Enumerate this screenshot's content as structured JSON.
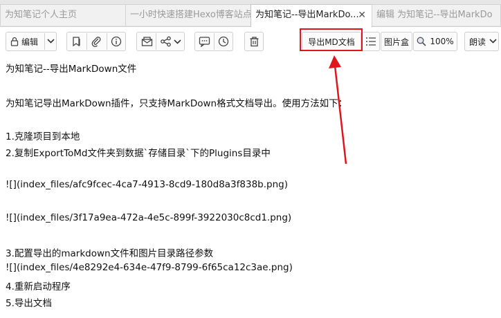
{
  "tabs": [
    {
      "label": "为知笔记个人主页"
    },
    {
      "label": "一小时快速搭建Hexo博客站点"
    },
    {
      "label": "为知笔记--导出MarkDo...",
      "close": "✕"
    },
    {
      "label": "编辑 为知笔记--导出MarkDo"
    }
  ],
  "toolbar": {
    "edit_label": "编辑",
    "export_md_label": "导出MD文档",
    "image_box_label": "图片盒",
    "zoom_label": "100%",
    "read_label": "朗读"
  },
  "colors": {
    "annotation": "#e0141b",
    "tab_bar": "#e6e6e6"
  },
  "document": {
    "title": "为知笔记--导出MarkDown文件",
    "intro": "为知笔记导出MarkDown插件，只支持MarkDown格式文档导出。使用方法如下：",
    "step1": "1.克隆项目到本地",
    "step2": "2.复制ExportToMd文件夹到数据`存储目录`下的Plugins目录中",
    "img1": "![](index_files/afc9fcec-4ca7-4913-8cd9-180d8a3f838b.png)",
    "img2": "![](index_files/3f17a9ea-472a-4e5c-899f-3922030c8cd1.png)",
    "step3": "3.配置导出的markdown文件和图片目录路径参数",
    "img3": "![](index_files/4e8292e4-634e-47f9-8799-6f65ca12c3ae.png)",
    "step4": "4.重新启动程序",
    "step5": "5.导出文档"
  }
}
